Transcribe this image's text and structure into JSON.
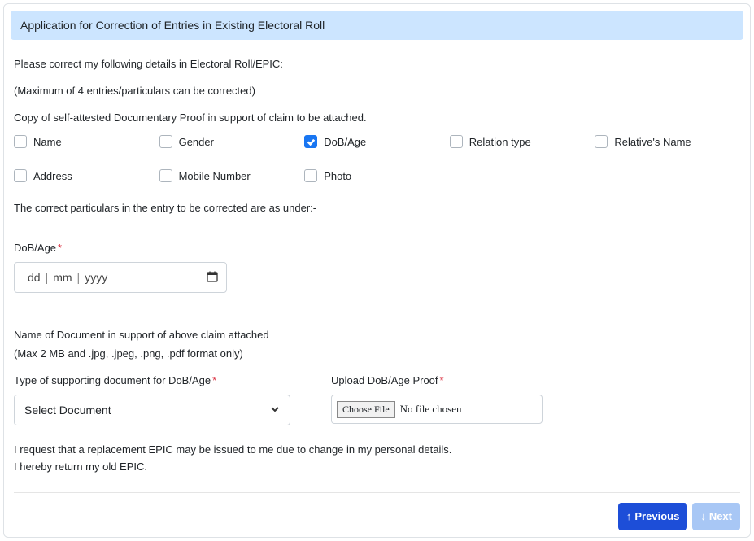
{
  "header": {
    "title": "Application for Correction of Entries in Existing Electoral Roll"
  },
  "intro": {
    "line1": "Please correct my following details in Electoral Roll/EPIC:",
    "line2": "(Maximum of 4 entries/particulars can be corrected)",
    "line3": "Copy of self-attested Documentary Proof in support of claim to be attached."
  },
  "checkboxes": [
    {
      "label": "Name",
      "checked": false
    },
    {
      "label": "Gender",
      "checked": false
    },
    {
      "label": "DoB/Age",
      "checked": true
    },
    {
      "label": "Relation type",
      "checked": false
    },
    {
      "label": "Relative's Name",
      "checked": false
    },
    {
      "label": "Address",
      "checked": false
    },
    {
      "label": "Mobile Number",
      "checked": false
    },
    {
      "label": "Photo",
      "checked": false
    }
  ],
  "correctLine": "The correct particulars in the entry to be corrected are as under:-",
  "dobField": {
    "label": "DoB/Age",
    "placeholder_dd": "dd",
    "placeholder_mm": "mm",
    "placeholder_yyyy": "yyyy"
  },
  "docSection": {
    "title": "Name of Document in support of above claim attached",
    "sub": "(Max 2 MB and .jpg, .jpeg, .png, .pdf format only)",
    "typeLabel": "Type of supporting document for DoB/Age",
    "selectPlaceholder": "Select Document",
    "uploadLabel": "Upload DoB/Age Proof",
    "chooseFile": "Choose File",
    "noFile": "No file chosen"
  },
  "declaration": {
    "line1": "I request that a replacement EPIC may be issued to me due to change in my personal details.",
    "line2": "I hereby return my old EPIC."
  },
  "buttons": {
    "prev": "Previous",
    "next": "Next"
  }
}
